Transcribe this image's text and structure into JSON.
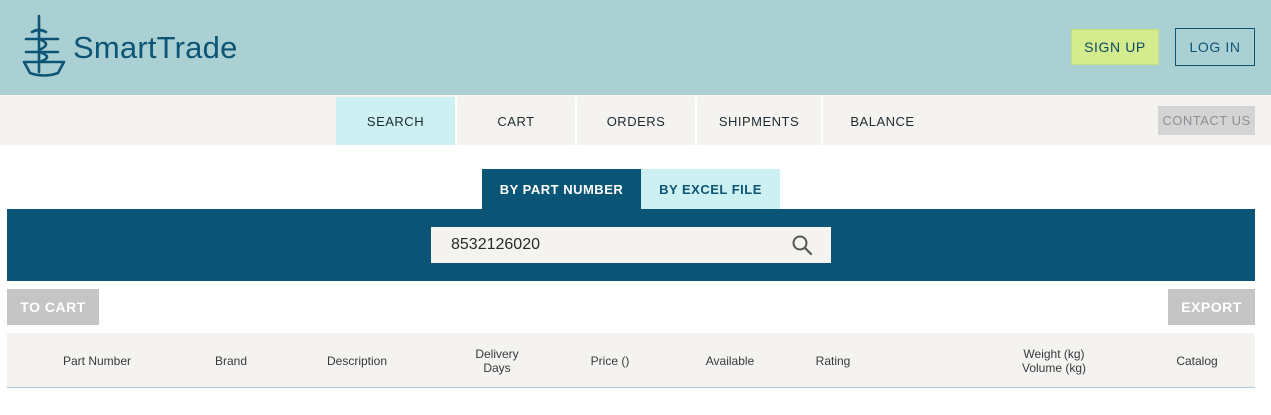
{
  "header": {
    "brand_name": "SmartTrade",
    "signup_label": "SIGN UP",
    "login_label": "LOG IN"
  },
  "nav": {
    "items": [
      {
        "label": "SEARCH",
        "active": true
      },
      {
        "label": "CART",
        "active": false
      },
      {
        "label": "ORDERS",
        "active": false
      },
      {
        "label": "SHIPMENTS",
        "active": false
      },
      {
        "label": "BALANCE",
        "active": false
      }
    ],
    "contact_label": "CONTACT US"
  },
  "search": {
    "tabs": [
      {
        "label": "BY PART NUMBER",
        "active": true
      },
      {
        "label": "BY EXCEL FILE",
        "active": false
      }
    ],
    "query": "8532126020"
  },
  "actions": {
    "to_cart_label": "TO CART",
    "export_label": "EXPORT"
  },
  "table": {
    "columns": [
      "Part Number",
      "Brand",
      "Description",
      "Delivery\nDays",
      "Price ()",
      "Available",
      "Rating",
      "Weight (kg)\nVolume (kg)",
      "Catalog"
    ]
  },
  "colors": {
    "header_bg": "#abd0d3",
    "brand": "#0d5577",
    "band": "#0a5475",
    "accent_light": "#cdf0f2",
    "signup_bg": "#d4ec8e"
  },
  "icons": {
    "logo": "ship-logo-icon",
    "search": "search-icon"
  }
}
